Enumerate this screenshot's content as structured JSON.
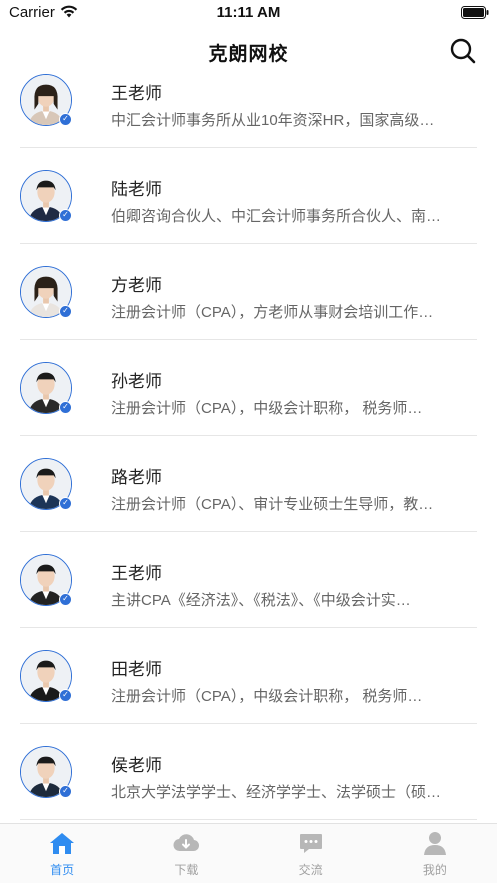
{
  "status_bar": {
    "carrier": "Carrier",
    "time": "11:11 AM"
  },
  "nav": {
    "title": "克朗网校",
    "search_icon": "search-icon"
  },
  "teachers": [
    {
      "name": "王老师",
      "desc": "中汇会计师事务所从业10年资深HR，国家高级…",
      "gender": "f",
      "suit": "#d8c7b8"
    },
    {
      "name": "陆老师",
      "desc": "伯卿咨询合伙人、中汇会计师事务所合伙人、南…",
      "gender": "m",
      "suit": "#1f2a44"
    },
    {
      "name": "方老师",
      "desc": "注册会计师（CPA），方老师从事财会培训工作…",
      "gender": "f",
      "suit": "#e9e4df"
    },
    {
      "name": "孙老师",
      "desc": "注册会计师（CPA），中级会计职称， 税务师…",
      "gender": "m",
      "suit": "#2a2a2a"
    },
    {
      "name": "路老师",
      "desc": "注册会计师（CPA）、审计专业硕士生导师，教…",
      "gender": "m",
      "suit": "#1d3557"
    },
    {
      "name": "王老师",
      "desc": "主讲CPA《经济法》、《税法》、《中级会计实…",
      "gender": "m",
      "suit": "#222222"
    },
    {
      "name": "田老师",
      "desc": "注册会计师（CPA），中级会计职称， 税务师…",
      "gender": "m",
      "suit": "#1a1a1a"
    },
    {
      "name": "侯老师",
      "desc": "北京大学法学学士、经济学学士、法学硕士（硕…",
      "gender": "m",
      "suit": "#1e2b3c"
    }
  ],
  "tabs": [
    {
      "label": "首页",
      "icon": "home-icon",
      "active": true
    },
    {
      "label": "下载",
      "icon": "download-icon",
      "active": false
    },
    {
      "label": "交流",
      "icon": "chat-icon",
      "active": false
    },
    {
      "label": "我的",
      "icon": "profile-icon",
      "active": false
    }
  ],
  "colors": {
    "accent": "#2f8cf0",
    "avatar_ring": "#2f6fd6",
    "inactive": "#a0a0a0"
  }
}
